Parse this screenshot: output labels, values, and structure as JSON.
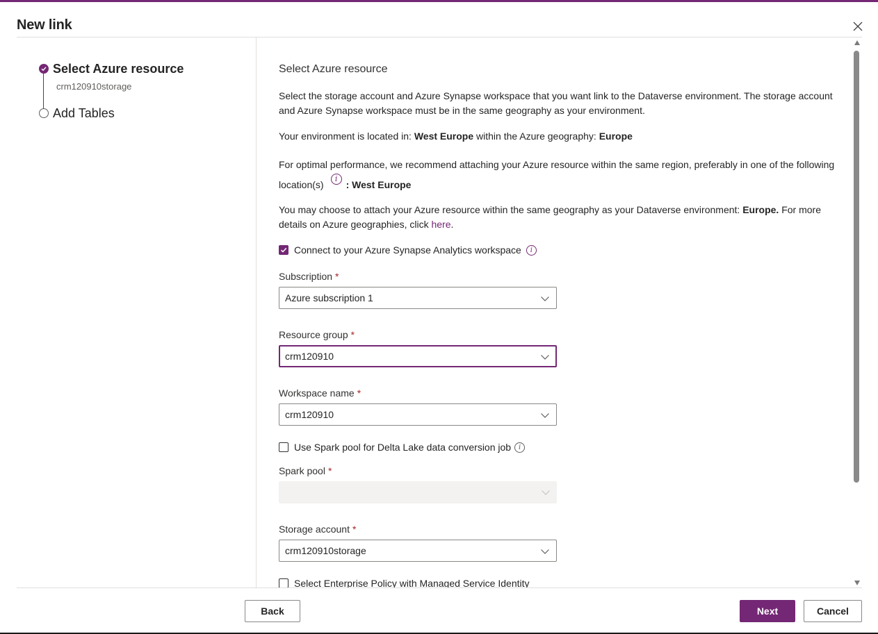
{
  "dialog": {
    "title": "New link"
  },
  "stepper": {
    "steps": [
      {
        "label": "Select Azure resource",
        "sublabel": "crm120910storage",
        "state": "done"
      },
      {
        "label": "Add Tables",
        "state": "todo"
      }
    ]
  },
  "content": {
    "section_title": "Select Azure resource",
    "intro": "Select the storage account and Azure Synapse workspace that you want link to the Dataverse environment. The storage account and Azure Synapse workspace must be in the same geography as your environment.",
    "env_location": {
      "prefix": "Your environment is located in: ",
      "region": "West Europe",
      "middle": " within the Azure geography: ",
      "geography": "Europe"
    },
    "recommend": {
      "text": "For optimal performance, we recommend attaching your Azure resource within the same region, preferably in one of the following location(s)",
      "locations": ": West Europe"
    },
    "geo_note": {
      "prefix": "You may choose to attach your Azure resource within the same geography as your Dataverse environment: ",
      "geography": "Europe.",
      "suffix": " For more details on Azure geographies, click ",
      "link": "here",
      "end": "."
    },
    "synapse_checkbox": {
      "label": "Connect to your Azure Synapse Analytics workspace",
      "checked": true
    },
    "subscription": {
      "label": "Subscription",
      "value": "Azure subscription 1"
    },
    "resource_group": {
      "label": "Resource group",
      "value": "crm120910"
    },
    "workspace": {
      "label": "Workspace name",
      "value": "crm120910"
    },
    "spark_checkbox": {
      "label": "Use Spark pool for Delta Lake data conversion job",
      "checked": false
    },
    "spark_pool": {
      "label": "Spark pool",
      "value": ""
    },
    "storage": {
      "label": "Storage account",
      "value": "crm120910storage"
    },
    "policy_checkbox": {
      "label": "Select Enterprise Policy with Managed Service Identity",
      "checked": false
    },
    "required_marker": "*"
  },
  "footer": {
    "back_label": "Back",
    "next_label": "Next",
    "cancel_label": "Cancel"
  },
  "colors": {
    "accent": "#742774",
    "required": "#a4262c"
  }
}
